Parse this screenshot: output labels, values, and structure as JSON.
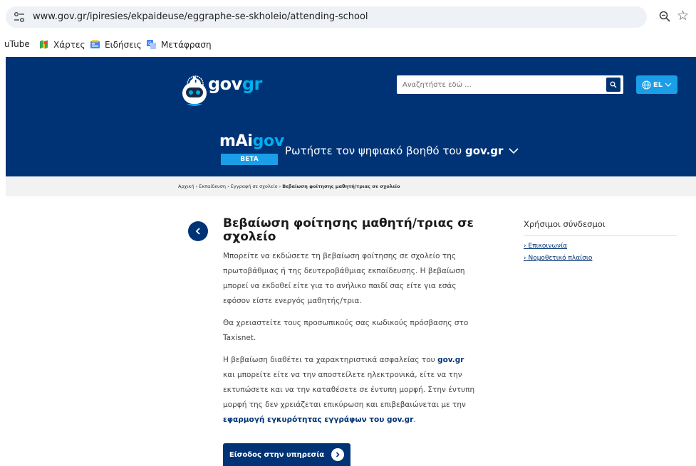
{
  "browser": {
    "url": "www.gov.gr/ipiresies/ekpaideuse/eggraphe-se-skholeio/attending-school",
    "bookmarks": [
      {
        "label": "uTube"
      },
      {
        "label": "Χάρτες"
      },
      {
        "label": "Ειδήσεις"
      },
      {
        "label": "Μετάφραση"
      }
    ]
  },
  "header": {
    "logo_gov": "gov",
    "logo_gr": "gr",
    "search_placeholder": "Αναζητήστε εδώ ...",
    "lang": "EL"
  },
  "mai": {
    "title_m": "mAi",
    "title_gov": "gov",
    "badge": "BETA",
    "subtitle": "Ρωτήστε τον ψηφιακό βοηθό του ",
    "subtitle_bold": "gov.gr"
  },
  "breadcrumb": {
    "items": [
      "Αρχική",
      "Εκπαίδευση",
      "Εγγραφή σε σχολείο"
    ],
    "separator": " › ",
    "current": "Βεβαίωση φοίτησης μαθητή/τριας σε σχολείο"
  },
  "main": {
    "title": "Βεβαίωση φοίτησης μαθητή/τριας σε σχολείο",
    "p1": "Μπορείτε να εκδώσετε τη βεβαίωση φοίτησης σε σχολείο της πρωτοβάθμιας ή της δευτεροβάθμιας εκπαίδευσης. Η βεβαίωση μπορεί να εκδοθεί είτε για το ανήλικο παιδί σας είτε για εσάς εφόσον είστε ενεργός μαθητής/τρια.",
    "p2": "Θα χρειαστείτε τους προσωπικούς σας κωδικούς πρόσβασης στο Taxisnet.",
    "p3_a": "Η βεβαίωση διαθέτει τα χαρακτηριστικά ασφαλείας του ",
    "p3_b": "gov.gr",
    "p3_c": " και μπορείτε είτε να την αποστείλετε ηλεκτρονικά, είτε να την εκτυπώσετε και να την καταθέσετε σε έντυπη μορφή. Στην έντυπη μορφή της δεν χρειάζεται επικύρωση και επιβεβαιώνεται με την ",
    "p3_d": "εφαρμογή εγκυρότητας εγγράφων του gov.gr",
    "p3_e": ".",
    "cta": "Είσοδος στην υπηρεσία"
  },
  "side": {
    "title": "Χρήσιμοι σύνδεσμοι",
    "links": [
      "Επικοινωνία",
      "Νομοθετικό πλαίσιο"
    ]
  },
  "colors": {
    "brand": "#003375",
    "accent": "#00aeef",
    "button_blue": "#1a9ee8"
  }
}
